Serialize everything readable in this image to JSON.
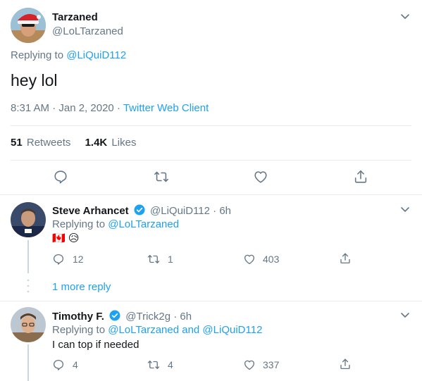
{
  "main_tweet": {
    "display_name": "Tarzaned",
    "handle": "@LoLTarzaned",
    "replying_to_prefix": "Replying to ",
    "replying_to_user": "@LiQuiD112",
    "text": "hey lol",
    "timestamp": "8:31 AM · Jan 2, 2020 · ",
    "client": "Twitter Web Client",
    "retweet_count": "51",
    "retweet_label": "Retweets",
    "like_count": "1.4K",
    "like_label": "Likes"
  },
  "replies": [
    {
      "display_name": "Steve Arhancet",
      "verified": true,
      "handle_time": "@LiQuiD112 · 6h",
      "replying_to_prefix": "Replying to ",
      "replying_to_users": "@LoLTarzaned",
      "text": "🇨🇦 😥",
      "reply_count": "12",
      "retweet_count": "1",
      "like_count": "403"
    },
    {
      "display_name": "Timothy F.",
      "verified": true,
      "handle_time": "@Trick2g · 6h",
      "replying_to_prefix": "Replying to ",
      "replying_to_users": "@LoLTarzaned and @LiQuiD112",
      "text": "I can top if needed",
      "reply_count": "4",
      "retweet_count": "4",
      "like_count": "337"
    }
  ],
  "more_replies": "1 more reply",
  "colors": {
    "accent": "#1da1f2",
    "secondary_text": "#657786",
    "divider": "#e6ecf0",
    "thread_line": "#ccd6dd"
  }
}
